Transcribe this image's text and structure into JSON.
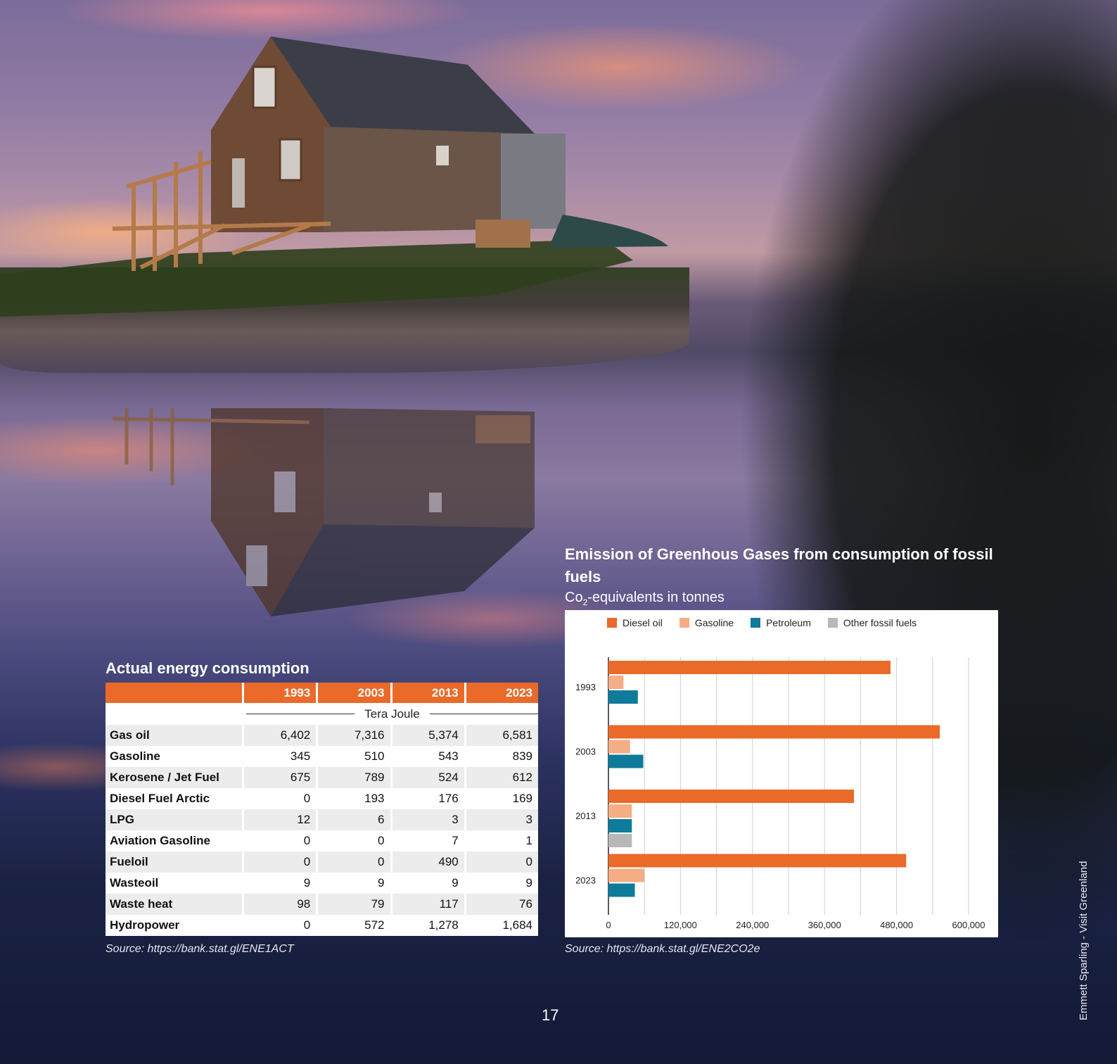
{
  "table": {
    "title": "Actual energy consumption",
    "unit": "Tera Joule",
    "columns": [
      "1993",
      "2003",
      "2013",
      "2023"
    ],
    "rows": [
      {
        "label": "Gas oil",
        "values": [
          "6,402",
          "7,316",
          "5,374",
          "6,581"
        ]
      },
      {
        "label": "Gasoline",
        "values": [
          "345",
          "510",
          "543",
          "839"
        ]
      },
      {
        "label": "Kerosene / Jet Fuel",
        "values": [
          "675",
          "789",
          "524",
          "612"
        ]
      },
      {
        "label": "Diesel Fuel Arctic",
        "values": [
          "0",
          "193",
          "176",
          "169"
        ]
      },
      {
        "label": "LPG",
        "values": [
          "12",
          "6",
          "3",
          "3"
        ]
      },
      {
        "label": "Aviation Gasoline",
        "values": [
          "0",
          "0",
          "7",
          "1"
        ]
      },
      {
        "label": "Fueloil",
        "values": [
          "0",
          "0",
          "490",
          "0"
        ]
      },
      {
        "label": "Wasteoil",
        "values": [
          "9",
          "9",
          "9",
          "9"
        ]
      },
      {
        "label": "Waste heat",
        "values": [
          "98",
          "79",
          "117",
          "76"
        ]
      },
      {
        "label": "Hydropower",
        "values": [
          "0",
          "572",
          "1,278",
          "1,684"
        ]
      }
    ],
    "source": "Source: https://bank.stat.gl/ENE1ACT"
  },
  "chart_data": {
    "type": "bar",
    "orientation": "horizontal",
    "title": "Emission of Greenhous Gases from consumption of fossil fuels",
    "subtitle_prefix": "Co",
    "subtitle_sub": "2",
    "subtitle_suffix": "-equivalents in tonnes",
    "categories": [
      "1993",
      "2003",
      "2013",
      "2023"
    ],
    "series": [
      {
        "name": "Diesel oil",
        "color": "#ea6a2a",
        "values": [
          470000,
          552000,
          409000,
          496000
        ]
      },
      {
        "name": "Gasoline",
        "color": "#f4ad84",
        "values": [
          25000,
          36000,
          39000,
          60000
        ]
      },
      {
        "name": "Petroleum",
        "color": "#0e7b9a",
        "values": [
          49000,
          58000,
          39000,
          44000
        ]
      },
      {
        "name": "Other fossil fuels",
        "color": "#b8b8b8",
        "values": [
          0,
          0,
          39000,
          0
        ]
      }
    ],
    "xlim": [
      0,
      600000
    ],
    "xticks": [
      "0",
      "120,000",
      "240,000",
      "360,000",
      "480,000",
      "600,000"
    ],
    "xtick_values": [
      0,
      120000,
      240000,
      360000,
      480000,
      600000
    ],
    "grid": true,
    "legend_position": "top",
    "source": "Source: https://bank.stat.gl/ENE2CO2e"
  },
  "page": {
    "number": "17",
    "photo_credit": "Emmett Sparling - Visit Greenland"
  }
}
